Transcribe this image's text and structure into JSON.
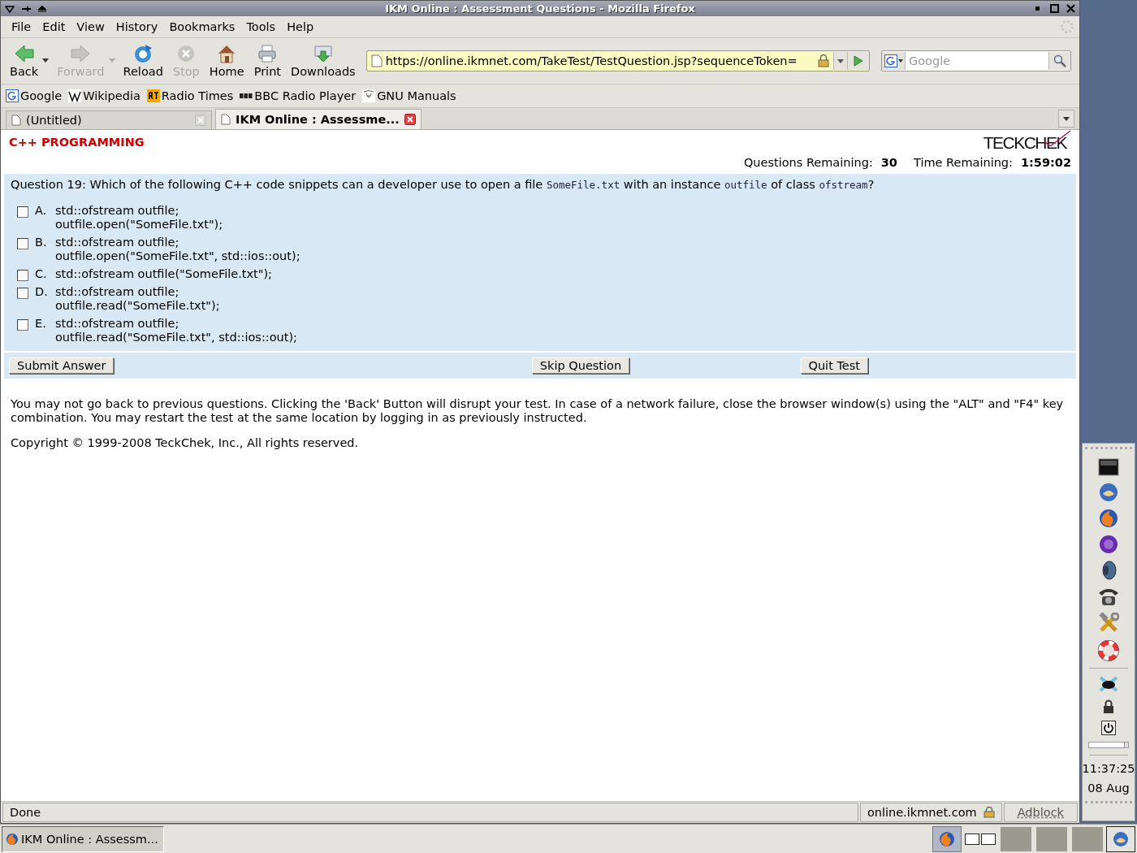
{
  "window": {
    "title": "IKM Online : Assessment Questions - Mozilla Firefox"
  },
  "menu": [
    "File",
    "Edit",
    "View",
    "History",
    "Bookmarks",
    "Tools",
    "Help"
  ],
  "toolbar": [
    {
      "label": "Back",
      "kind": "back",
      "disabled": false,
      "dropdown": true
    },
    {
      "label": "Forward",
      "kind": "forward",
      "disabled": true,
      "dropdown": true
    },
    {
      "label": "Reload",
      "kind": "reload",
      "disabled": false,
      "dropdown": false
    },
    {
      "label": "Stop",
      "kind": "stop",
      "disabled": true,
      "dropdown": false
    },
    {
      "label": "Home",
      "kind": "home",
      "disabled": false,
      "dropdown": false
    },
    {
      "label": "Print",
      "kind": "print",
      "disabled": false,
      "dropdown": false
    },
    {
      "label": "Downloads",
      "kind": "downloads",
      "disabled": false,
      "dropdown": false
    }
  ],
  "address": {
    "url": "https://online.ikmnet.com/TakeTest/TestQuestion.jsp?sequenceToken="
  },
  "search": {
    "placeholder": "Google"
  },
  "bookmarks": [
    {
      "label": "Google",
      "kind": "google"
    },
    {
      "label": "Wikipedia",
      "kind": "wikipedia"
    },
    {
      "label": "Radio Times",
      "kind": "rt"
    },
    {
      "label": "BBC Radio Player",
      "kind": "bbc"
    },
    {
      "label": "GNU Manuals",
      "kind": "gnu"
    }
  ],
  "tabs": [
    {
      "label": "(Untitled)",
      "selected": false
    },
    {
      "label": "IKM Online : Assessme...",
      "selected": true
    }
  ],
  "page": {
    "heading": "C++ PROGRAMMING",
    "logo": "TECKCHEK",
    "questions_remaining": {
      "label": "Questions Remaining:",
      "value": "30"
    },
    "time_remaining": {
      "label": "Time Remaining:",
      "value": "1:59:02"
    },
    "question": [
      {
        "kind": "text",
        "text": "Question 19: Which of the following C++ code snippets can a developer use to open a file"
      },
      {
        "kind": "code",
        "text": "SomeFile.txt"
      },
      {
        "kind": "text",
        "text": "with an instance"
      },
      {
        "kind": "code",
        "text": "outfile"
      },
      {
        "kind": "text",
        "text": "of class"
      },
      {
        "kind": "code",
        "text": "ofstream"
      },
      {
        "kind": "text",
        "text": "?"
      }
    ],
    "options": [
      {
        "letter": "A.",
        "lines": [
          "std::ofstream outfile;",
          "outfile.open(\"SomeFile.txt\");"
        ],
        "checked": false
      },
      {
        "letter": "B.",
        "lines": [
          "std::ofstream outfile;",
          "outfile.open(\"SomeFile.txt\", std::ios::out);"
        ],
        "checked": false
      },
      {
        "letter": "C.",
        "lines": [
          "std::ofstream outfile(\"SomeFile.txt\");"
        ],
        "checked": false
      },
      {
        "letter": "D.",
        "lines": [
          "std::ofstream outfile;",
          "outfile.read(\"SomeFile.txt\");"
        ],
        "checked": false
      },
      {
        "letter": "E.",
        "lines": [
          "std::ofstream outfile;",
          "outfile.read(\"SomeFile.txt\", std::ios::out);"
        ],
        "checked": false
      }
    ],
    "buttons": [
      "Submit Answer",
      "Skip Question",
      "Quit Test"
    ],
    "notice": "You may not go back to previous questions. Clicking the 'Back' Button will disrupt your test. In case of a network failure, close the browser window(s) using the \"ALT\" and \"F4\" key combination. You may restart the test at the same location by logging in as previously instructed.",
    "copyright": "Copyright © 1999-2008 TeckChek, Inc., All rights reserved."
  },
  "status_bar": {
    "text": "Done",
    "host": "online.ikmnet.com",
    "addon": "Adblock"
  },
  "dock": {
    "volume": {
      "level": 0.9
    },
    "time": "11:37:25",
    "date": "08 Aug"
  },
  "taskbar": {
    "tasks": [
      {
        "label": "IKM Online : Assessm...",
        "selected": true
      }
    ]
  }
}
